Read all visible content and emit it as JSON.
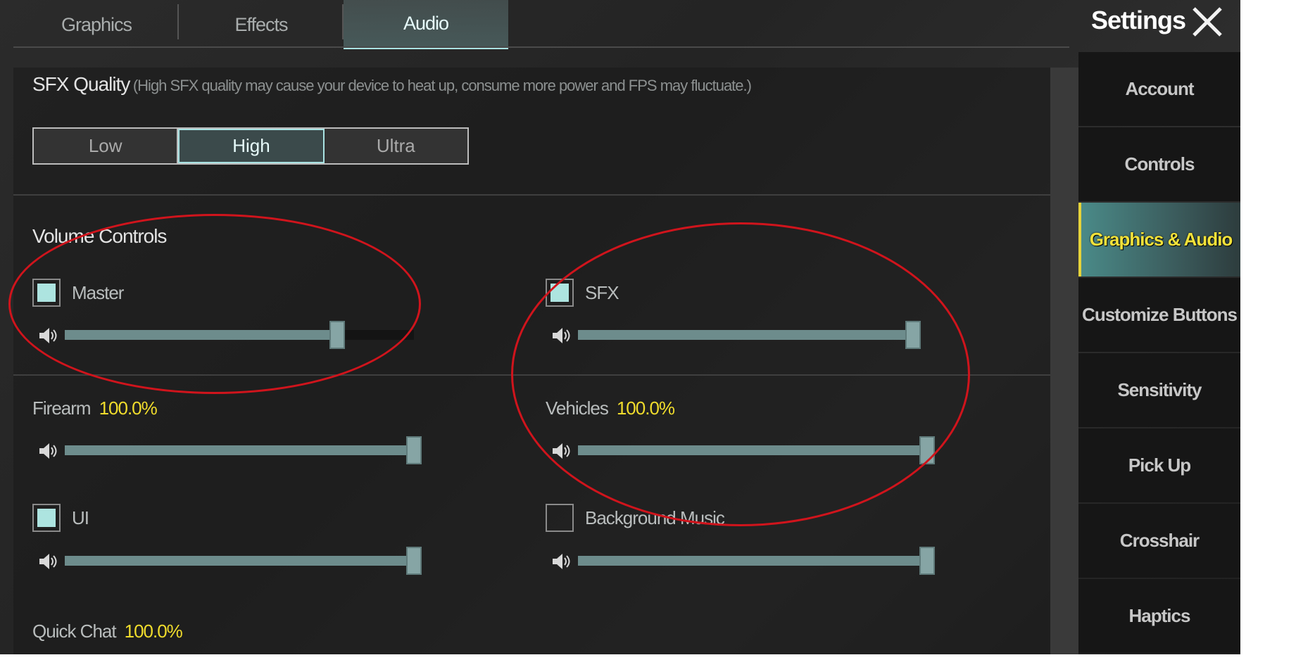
{
  "tabs": [
    {
      "label": "Graphics",
      "active": false
    },
    {
      "label": "Effects",
      "active": false
    },
    {
      "label": "Audio",
      "active": true
    }
  ],
  "header": {
    "title": "Settings",
    "close_icon": "close-x-icon"
  },
  "sidebar": {
    "items": [
      {
        "label": "Account",
        "active": false
      },
      {
        "label": "Controls",
        "active": false
      },
      {
        "label": "Graphics & Audio",
        "active": true
      },
      {
        "label": "Customize Buttons",
        "active": false
      },
      {
        "label": "Sensitivity",
        "active": false
      },
      {
        "label": "Pick Up",
        "active": false
      },
      {
        "label": "Crosshair",
        "active": false
      },
      {
        "label": "Haptics",
        "active": false
      }
    ]
  },
  "sfx_quality": {
    "title": "SFX Quality",
    "note": "(High SFX quality may cause your device to heat up, consume more power and FPS may fluctuate.)",
    "options": [
      "Low",
      "High",
      "Ultra"
    ],
    "selected": "High"
  },
  "volume": {
    "title": "Volume Controls",
    "master": {
      "label": "Master",
      "checked": true,
      "value": 0.78
    },
    "sfx": {
      "label": "SFX",
      "checked": true,
      "value": 1.0
    },
    "firearm": {
      "label": "Firearm",
      "percent": "100.0%",
      "value": 1.0
    },
    "vehicles": {
      "label": "Vehicles",
      "percent": "100.0%",
      "value": 1.0
    },
    "ui": {
      "label": "UI",
      "checked": true,
      "value": 1.0
    },
    "background_music": {
      "label": "Background Music",
      "checked": false,
      "value": 1.0
    },
    "quick_chat": {
      "label": "Quick Chat",
      "percent": "100.0%"
    }
  },
  "colors": {
    "accent": "#a9e3e3",
    "highlight": "#f0dc2c",
    "annotation": "#d0141c"
  }
}
